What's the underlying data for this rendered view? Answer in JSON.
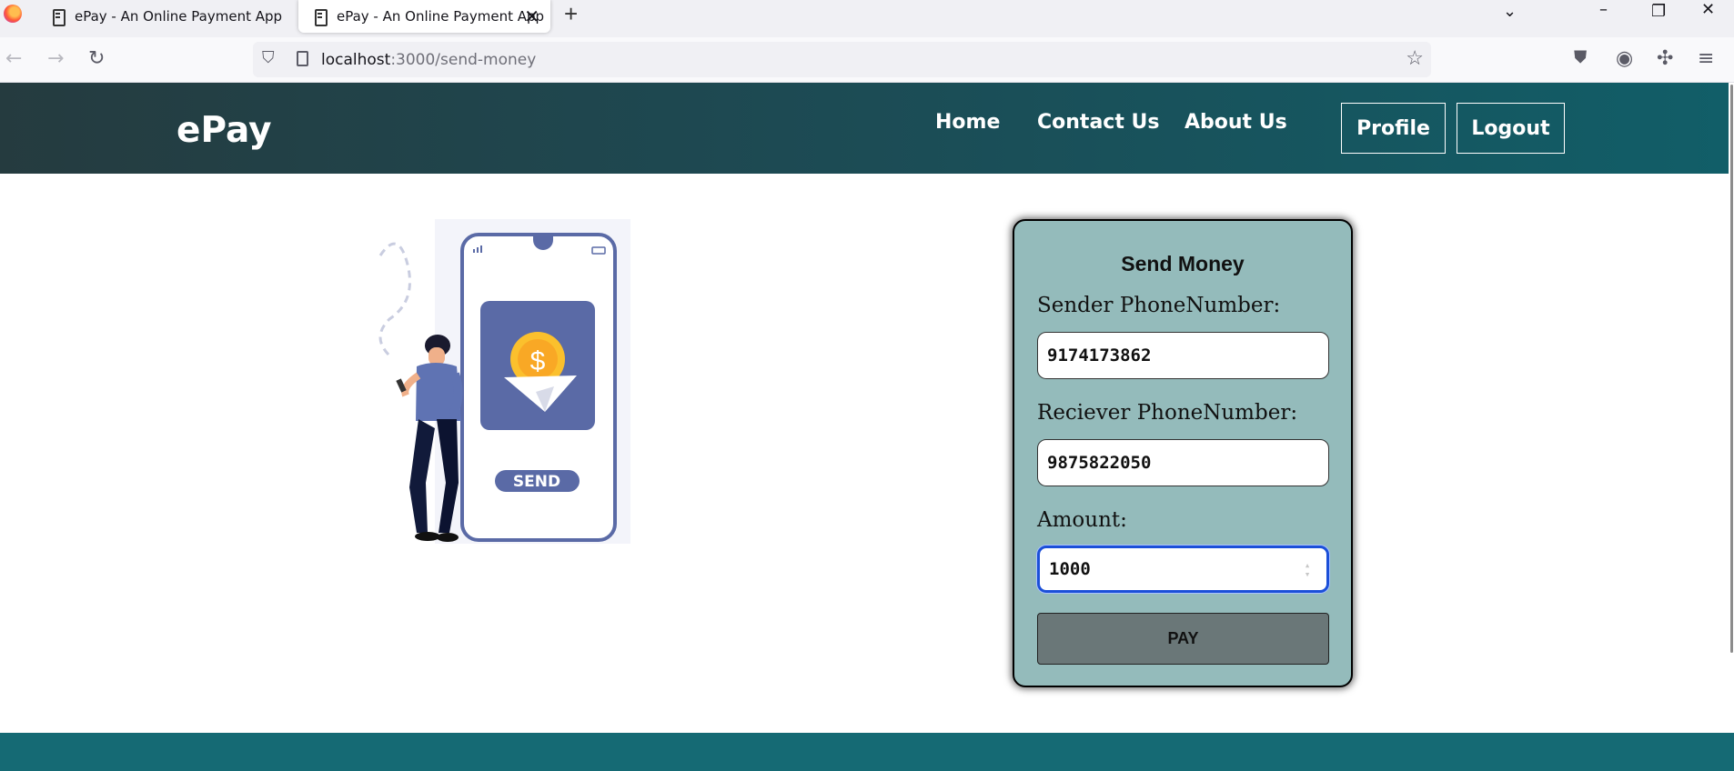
{
  "browser": {
    "tabs": [
      {
        "title": "ePay - An Online Payment App"
      },
      {
        "title": "ePay - An Online Payment App"
      }
    ],
    "url_host": "localhost",
    "url_path": ":3000/send-money"
  },
  "header": {
    "brand": "ePay",
    "nav": [
      "Home",
      "Contact Us",
      "About Us"
    ],
    "profile_label": "Profile",
    "logout_label": "Logout"
  },
  "illustration": {
    "send_label": "SEND",
    "coin_symbol": "$"
  },
  "form": {
    "title": "Send Money",
    "sender_label": "Sender PhoneNumber:",
    "sender_value": "9174173862",
    "receiver_label": "Reciever PhoneNumber:",
    "receiver_value": "9875822050",
    "amount_label": "Amount:",
    "amount_value": "1000",
    "pay_label": "PAY"
  },
  "colors": {
    "header_gradient_start": "#253b3f",
    "header_gradient_end": "#115e68",
    "card_bg": "#94bbbb",
    "pay_button": "#6a7778",
    "footer": "#156a74"
  }
}
